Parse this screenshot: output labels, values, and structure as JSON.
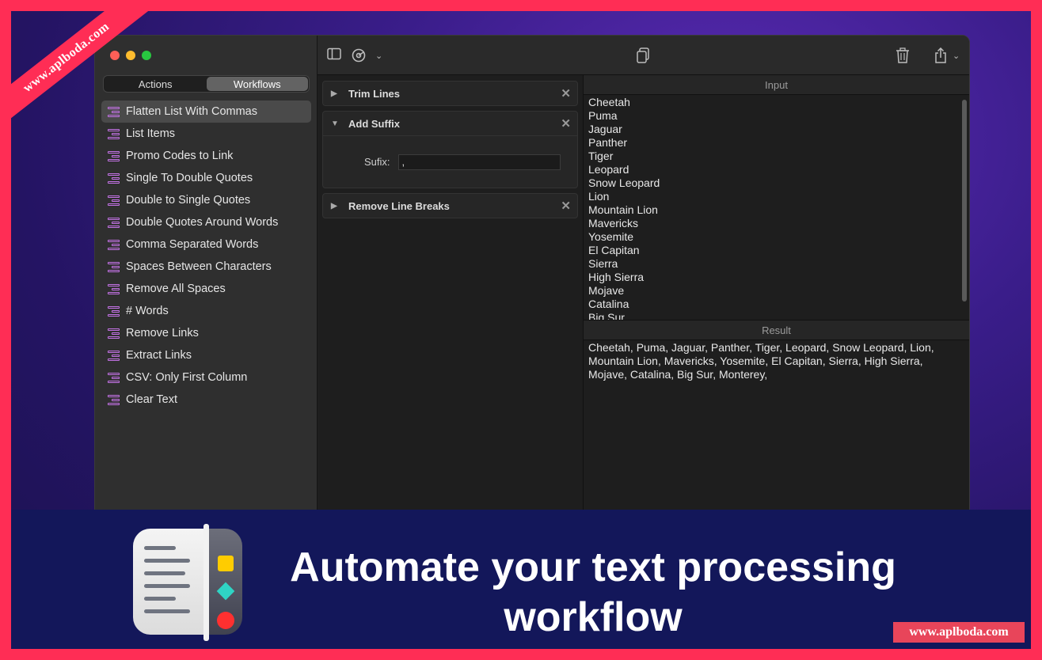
{
  "watermark": {
    "ribbon_text": "www.aplboda.com",
    "box_text": "www.aplboda.com"
  },
  "sidebar": {
    "segments": [
      {
        "label": "Actions",
        "active": false
      },
      {
        "label": "Workflows",
        "active": true
      }
    ],
    "workflows": [
      "Flatten List With Commas",
      "List Items",
      "Promo Codes to Link",
      "Single To Double Quotes",
      "Double to Single Quotes",
      "Double Quotes Around Words",
      "Comma Separated Words",
      "Spaces Between Characters",
      "Remove All Spaces",
      "# Words",
      "Remove Links",
      "Extract Links",
      "CSV: Only First Column",
      "Clear Text"
    ],
    "selected_index": 0
  },
  "toolbar": {
    "icons": [
      "sidebar-toggle-icon",
      "gear-icon",
      "chevron-down-icon",
      "copy-icon",
      "trash-icon",
      "share-icon",
      "chevron-down-icon"
    ]
  },
  "actions": [
    {
      "title": "Trim Lines",
      "expanded": false
    },
    {
      "title": "Add Suffix",
      "expanded": true,
      "field_label": "Sufix:",
      "field_value": ","
    },
    {
      "title": "Remove Line Breaks",
      "expanded": false
    }
  ],
  "input": {
    "header": "Input",
    "lines": [
      "Cheetah",
      "Puma",
      "Jaguar",
      "Panther",
      "Tiger",
      "Leopard",
      "Snow Leopard",
      "Lion",
      "Mountain Lion",
      "Mavericks",
      "Yosemite",
      "El Capitan",
      "Sierra",
      "High Sierra",
      "Mojave",
      "Catalina",
      "Big Sur"
    ]
  },
  "result": {
    "header": "Result",
    "text": "Cheetah, Puma, Jaguar, Panther, Tiger, Leopard, Snow Leopard, Lion, Mountain Lion, Mavericks, Yosemite, El Capitan, Sierra, High Sierra, Mojave, Catalina, Big Sur, Monterey,"
  },
  "banner": {
    "headline": "Automate your text processing workflow"
  }
}
